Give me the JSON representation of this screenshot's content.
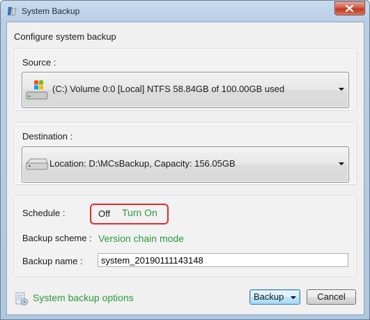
{
  "window": {
    "title": "System Backup"
  },
  "heading": "Configure system backup",
  "source": {
    "label": "Source :",
    "value": "(C:) Volume 0:0 [Local] NTFS   58.84GB of 100.00GB used"
  },
  "destination": {
    "label": "Destination :",
    "value": "Location: D:\\MCsBackup, Capacity: 156.05GB"
  },
  "schedule": {
    "label": "Schedule :",
    "state": "Off",
    "toggle_link": "Turn On"
  },
  "backup_scheme": {
    "label": "Backup scheme :",
    "value": "Version chain mode"
  },
  "backup_name": {
    "label": "Backup name :",
    "value": "system_20190111143148"
  },
  "footer": {
    "options_link": "System backup options",
    "backup_button": "Backup",
    "cancel_button": "Cancel"
  },
  "colors": {
    "link_green": "#2a9a3d",
    "highlight_red": "#e8262a"
  },
  "icons": {
    "app": "app-icon",
    "close": "close-icon",
    "source": "windows-drive-icon",
    "destination": "drive-icon",
    "options": "options-icon"
  }
}
